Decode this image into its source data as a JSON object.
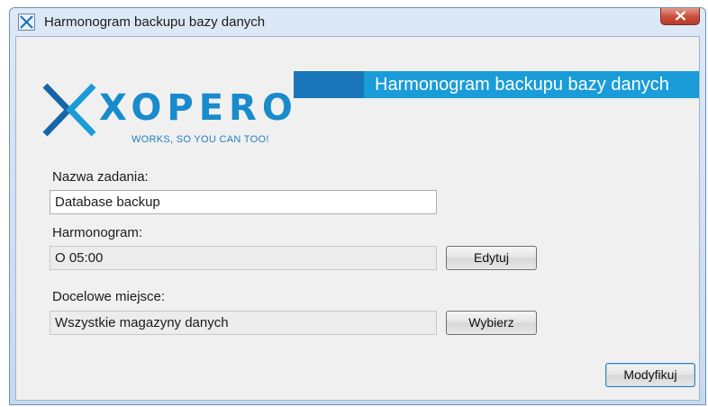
{
  "window": {
    "title": "Harmonogram backupu bazy danych"
  },
  "banner": {
    "title": "Harmonogram backupu bazy danych"
  },
  "logo": {
    "name": "XOPERO",
    "tagline": "WORKS, SO YOU CAN TOO!"
  },
  "form": {
    "task_name_label": "Nazwa zadania:",
    "task_name_value": "Database backup",
    "schedule_label": "Harmonogram:",
    "schedule_value": "O 05:00",
    "edit_button": "Edytuj",
    "destination_label": "Docelowe miejsce:",
    "destination_value": "Wszystkie magazyny danych",
    "choose_button": "Wybierz",
    "modify_button": "Modyfikuj"
  },
  "icons": {
    "app": "xopero-app-icon",
    "close": "close-icon"
  },
  "colors": {
    "banner_dark": "#1976b8",
    "banner_light": "#1a9cd8",
    "brand": "#178bcc"
  }
}
